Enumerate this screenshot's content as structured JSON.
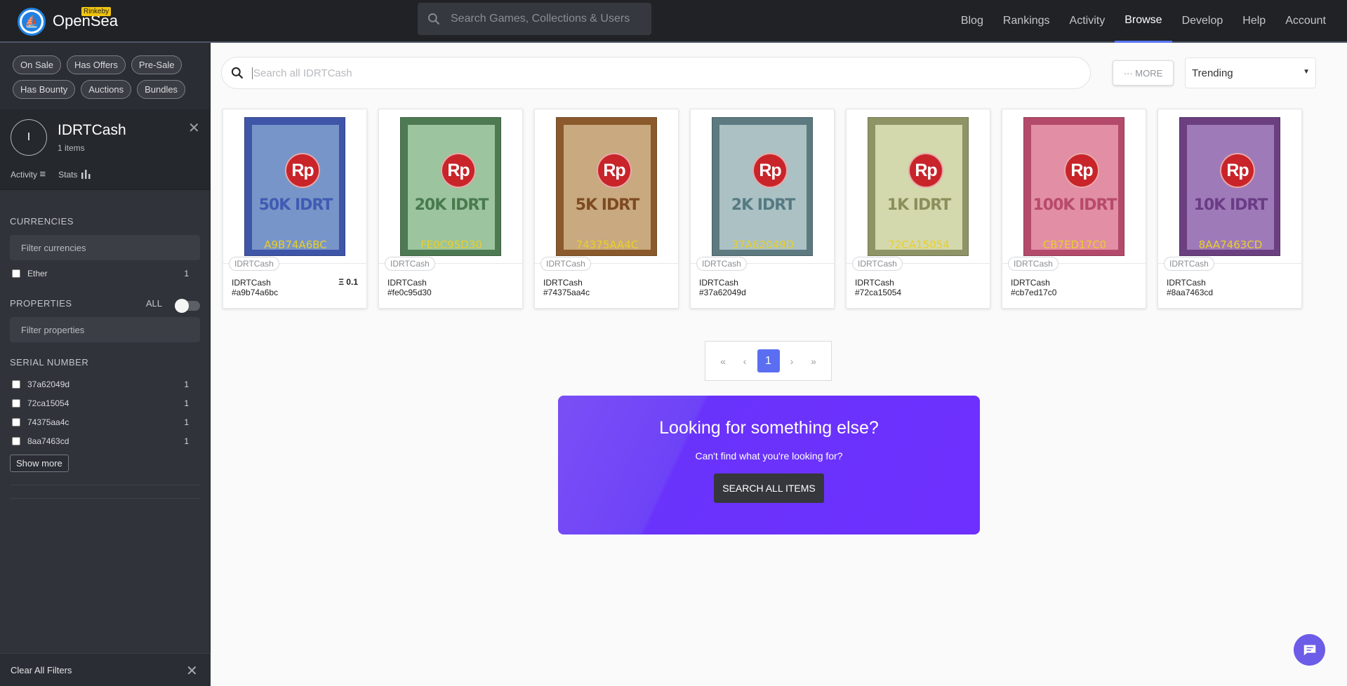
{
  "header": {
    "brand": "OpenSea",
    "badge": "Rinkeby",
    "search_placeholder": "Search Games, Collections & Users",
    "nav": [
      "Blog",
      "Rankings",
      "Activity",
      "Browse",
      "Develop",
      "Help",
      "Account"
    ],
    "active_nav": "Browse"
  },
  "sidebar": {
    "filter_pills": [
      "On Sale",
      "Has Offers",
      "Pre-Sale",
      "Has Bounty",
      "Auctions",
      "Bundles"
    ],
    "collection": {
      "initial": "I",
      "name": "IDRTCash",
      "count": "1 items",
      "activity_label": "Activity",
      "stats_label": "Stats"
    },
    "currencies": {
      "title": "CURRENCIES",
      "filter_placeholder": "Filter currencies",
      "items": [
        {
          "label": "Ether",
          "count": "1"
        }
      ]
    },
    "properties": {
      "title": "PROPERTIES",
      "all_label": "ALL",
      "filter_placeholder": "Filter properties"
    },
    "serial": {
      "title": "SERIAL NUMBER",
      "items": [
        {
          "label": "37a62049d",
          "count": "1"
        },
        {
          "label": "72ca15054",
          "count": "1"
        },
        {
          "label": "74375aa4c",
          "count": "1"
        },
        {
          "label": "8aa7463cd",
          "count": "1"
        }
      ],
      "show_more": "Show more"
    },
    "clear_all": "Clear All Filters"
  },
  "main": {
    "search_placeholder": "Search all IDRTCash",
    "more_label": "··· MORE",
    "sort_value": "Trending",
    "cards": [
      {
        "tag": "IDRTCash",
        "collection": "IDRTCash",
        "id": "#a9b74a6bc",
        "price": "Ξ 0.1",
        "amount": "50K IDRT",
        "code": "A9B74A6BC",
        "frame": "#3f55a8",
        "bg": "#7895c9",
        "text": "#3f5bb3"
      },
      {
        "tag": "IDRTCash",
        "collection": "IDRTCash",
        "id": "#fe0c95d30",
        "price": "",
        "amount": "20K IDRT",
        "code": "FE0C95D30",
        "frame": "#4d7a52",
        "bg": "#9cc49e",
        "text": "#4a7a4f"
      },
      {
        "tag": "IDRTCash",
        "collection": "IDRTCash",
        "id": "#74375aa4c",
        "price": "",
        "amount": "5K IDRT",
        "code": "74375AA4C",
        "frame": "#8a5a2c",
        "bg": "#c9a97f",
        "text": "#7d4a22"
      },
      {
        "tag": "IDRTCash",
        "collection": "IDRTCash",
        "id": "#37a62049d",
        "price": "",
        "amount": "2K IDRT",
        "code": "37A62049D",
        "frame": "#5c7a80",
        "bg": "#abc1c4",
        "text": "#557a82"
      },
      {
        "tag": "IDRTCash",
        "collection": "IDRTCash",
        "id": "#72ca15054",
        "price": "",
        "amount": "1K IDRT",
        "code": "72CA15054",
        "frame": "#8e9466",
        "bg": "#d4d8ad",
        "text": "#8a8f5c"
      },
      {
        "tag": "IDRTCash",
        "collection": "IDRTCash",
        "id": "#cb7ed17c0",
        "price": "",
        "amount": "100K IDRT",
        "code": "CB7ED17C0",
        "frame": "#b44a6b",
        "bg": "#e28ea4",
        "text": "#b74a6b"
      },
      {
        "tag": "IDRTCash",
        "collection": "IDRTCash",
        "id": "#8aa7463cd",
        "price": "",
        "amount": "10K IDRT",
        "code": "8AA7463CD",
        "frame": "#6b3f80",
        "bg": "#9f7ab8",
        "text": "#6a3c86"
      }
    ],
    "pagination": {
      "first": "«",
      "prev": "‹",
      "current": "1",
      "next": "›",
      "last": "»"
    },
    "promo": {
      "title": "Looking for something else?",
      "subtitle": "Can't find what you're looking for?",
      "button": "SEARCH ALL ITEMS"
    }
  },
  "icons": {
    "search": "search-icon",
    "close": "close-icon",
    "chat": "chat-icon",
    "activity": "list-icon",
    "stats": "bar-chart-icon"
  },
  "colors": {
    "accent": "#5877f5",
    "promo": "#6a33fb",
    "topbar": "#202225",
    "sidebar": "#303339"
  }
}
